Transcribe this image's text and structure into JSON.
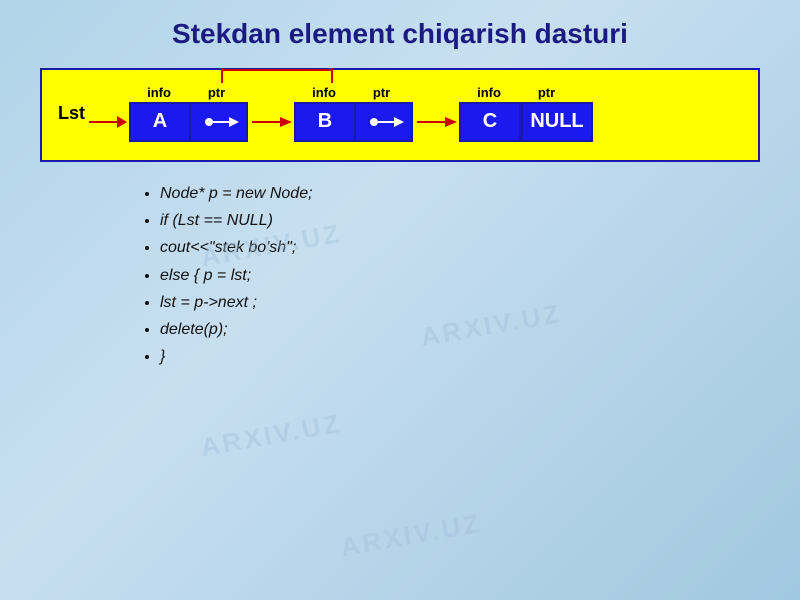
{
  "page": {
    "title": "Stekdan element chiqarish dasturi",
    "title_color": "#1a1a80"
  },
  "diagram": {
    "lst_label": "Lst",
    "nodes": [
      {
        "info_label": "info",
        "ptr_label": "ptr",
        "info_value": "A",
        "has_null": false
      },
      {
        "info_label": "info",
        "ptr_label": "ptr",
        "info_value": "B",
        "has_null": false
      },
      {
        "info_label": "info",
        "ptr_label": "ptr",
        "info_value": "C",
        "has_null": true,
        "null_value": "NULL"
      }
    ]
  },
  "code": {
    "lines": [
      "Node* p = new Node;",
      "if (Lst == NULL)",
      "cout<<\"stek bo'sh\";",
      "else { p = lst;",
      "lst = p->next ;",
      "delete(p);",
      "}"
    ]
  },
  "watermarks": [
    "ARXIV.UZ",
    "ARXIV.UZ",
    "ARXIV.UZ",
    "ARXIV.UZ"
  ]
}
